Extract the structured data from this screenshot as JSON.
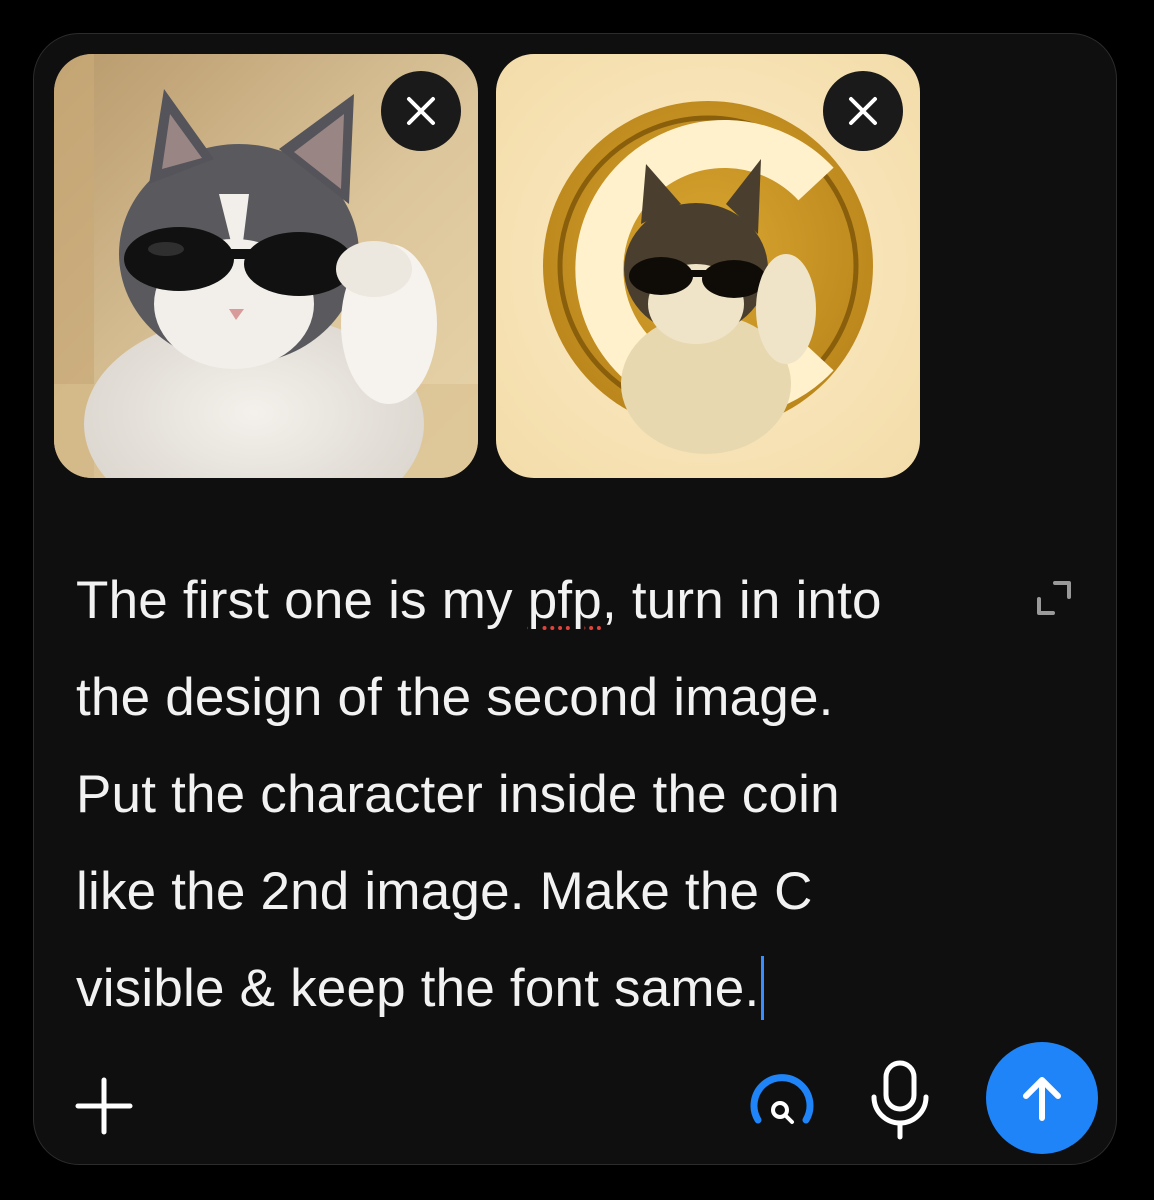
{
  "attachments": [
    {
      "name": "Cat wearing sunglasses profile picture",
      "icon": "cat-photo"
    },
    {
      "name": "Gold coin with C logo featuring cat",
      "icon": "coin-photo"
    }
  ],
  "composer": {
    "message_lines": [
      {
        "before": "The first one is my ",
        "misspelled": "pfp",
        "after": ", turn in into"
      },
      {
        "text": "the design of the second image."
      },
      {
        "text": "Put the character inside the coin"
      },
      {
        "text": "like the 2nd image. Make the C"
      },
      {
        "text": "visible & keep the font same."
      }
    ]
  },
  "toolbar": {
    "add_icon": "plus-icon",
    "tools_icon": "search-tools-icon",
    "mic_icon": "microphone-icon",
    "send_icon": "arrow-up-icon",
    "expand_icon": "expand-icon"
  },
  "colors": {
    "accent": "#1f84f7",
    "background": "#000000",
    "panel": "#0f0f0f",
    "text": "#f2f2f2",
    "spellcheck": "#e0433a"
  }
}
